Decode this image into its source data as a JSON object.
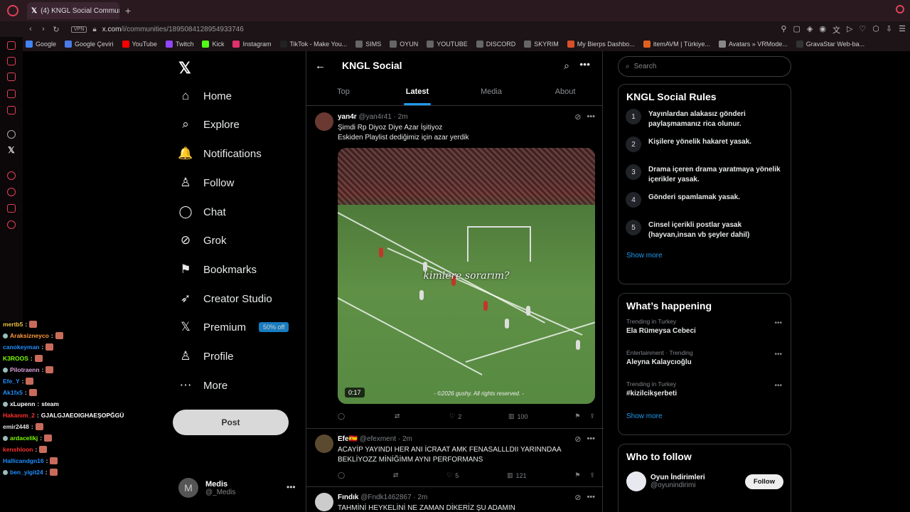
{
  "browser": {
    "tab_title": "(4) KNGL Social Commun",
    "new_tab": "+",
    "vpn": "VPN",
    "url_host": "x.com",
    "url_path": "/i/communities/1895084128954933746",
    "bookmarks": [
      {
        "label": "Google",
        "color": "#4285f4"
      },
      {
        "label": "Google Çeviri",
        "color": "#4a7be8"
      },
      {
        "label": "YouTube",
        "color": "#ff0000"
      },
      {
        "label": "Twitch",
        "color": "#9146ff"
      },
      {
        "label": "Kick",
        "color": "#53fc18"
      },
      {
        "label": "Instagram",
        "color": "#e1306c"
      },
      {
        "label": "TikTok - Make You...",
        "color": "#222"
      },
      {
        "label": "SIMS",
        "color": "#666"
      },
      {
        "label": "OYUN",
        "color": "#666"
      },
      {
        "label": "YOUTUBE",
        "color": "#666"
      },
      {
        "label": "DISCORD",
        "color": "#666"
      },
      {
        "label": "SKYRIM",
        "color": "#666"
      },
      {
        "label": "My Bierps Dashbo...",
        "color": "#d8502a"
      },
      {
        "label": "itemAVM | Türkiye...",
        "color": "#e06020"
      },
      {
        "label": "Avatars » VRMode...",
        "color": "#888"
      },
      {
        "label": "GravaStar Web-ba...",
        "color": "#333"
      }
    ]
  },
  "chat": [
    {
      "user": "mertb5",
      "color": "#f0c040",
      "text": ""
    },
    {
      "user": "Araksizneyco",
      "color": "#ff9a3c",
      "text": ""
    },
    {
      "user": "canokeyman",
      "color": "#1e90ff",
      "text": ""
    },
    {
      "user": "K3ROOS",
      "color": "#7cfc00",
      "text": ""
    },
    {
      "user": "Pilotraenn",
      "color": "#dda0dd",
      "text": ""
    },
    {
      "user": "Efe_Y",
      "color": "#1e90ff",
      "text": ""
    },
    {
      "user": "Ak1fx5",
      "color": "#1e90ff",
      "text": ""
    },
    {
      "user": "xLupenn",
      "color": "#ffffff",
      "text": "steam"
    },
    {
      "user": "Hakanım_2",
      "color": "#ff3030",
      "text": "GJALGJAEOIGHAEŞOPĞGÜ"
    },
    {
      "user": "emir2448",
      "color": "#e0e0e0",
      "text": ""
    },
    {
      "user": "ardacelikj",
      "color": "#7cfc00",
      "text": ""
    },
    {
      "user": "kenshloon",
      "color": "#ff3030",
      "text": ""
    },
    {
      "user": "Hallicandgn16",
      "color": "#1e90ff",
      "text": ""
    },
    {
      "user": "ben_yigit24",
      "color": "#1e90ff",
      "text": ""
    }
  ],
  "nav": {
    "items": [
      {
        "label": "Home",
        "icon": "⌂"
      },
      {
        "label": "Explore",
        "icon": "⌕"
      },
      {
        "label": "Notifications",
        "icon": "🔔"
      },
      {
        "label": "Follow",
        "icon": "♙"
      },
      {
        "label": "Chat",
        "icon": "◯"
      },
      {
        "label": "Grok",
        "icon": "⊘"
      },
      {
        "label": "Bookmarks",
        "icon": "⚑"
      },
      {
        "label": "Creator Studio",
        "icon": "➶"
      },
      {
        "label": "Premium",
        "icon": "𝕏"
      },
      {
        "label": "Profile",
        "icon": "♙"
      },
      {
        "label": "More",
        "icon": "⋯"
      }
    ],
    "premium_badge": "50% off",
    "post_label": "Post",
    "account_initial": "M",
    "account_name": "Medis",
    "account_handle": "@_Medis"
  },
  "community": {
    "title": "KNGL Social",
    "tabs": [
      "Top",
      "Latest",
      "Media",
      "About"
    ],
    "active_tab": "Latest"
  },
  "tweets": [
    {
      "name": "yan4r",
      "handle": "@yan4r41 · 2m",
      "text_1": "Şimdi Rp Diyoz Diye Azar İşitiyoz",
      "text_2": "Eskiden Playlist dediğimiz için azar yerdik",
      "video_caption": "kimlere sorarım?",
      "duration": "0:17",
      "watermark": "- ©2026 gushy. All rights reserved. -",
      "replies": "",
      "reposts": "",
      "likes": "2",
      "views": "100"
    },
    {
      "name": "Efe",
      "handle": "@efexment · 2m",
      "text_1": "ACAYİP YAYINDI HER ANI İCRAAT AMK FENASALLLDII YARINNDAA",
      "text_2": "BEKLİYOZZ MİNİĞİMM AYNI PERFORMANS",
      "likes": "5",
      "views": "121"
    },
    {
      "name": "Fındık",
      "handle": "@Fndk1462867 · 2m",
      "text_1": "TAHMİNİ HEYKELİNİ NE ZAMAN DİKERİZ ŞU ADAMIN"
    }
  ],
  "rules": {
    "title": "KNGL Social Rules",
    "items": [
      {
        "num": "1",
        "text": "Yayınlardan alakasız gönderi paylaşmamanız rica olunur."
      },
      {
        "num": "2",
        "text": "Kişilere yönelik hakaret yasak."
      },
      {
        "num": "3",
        "text": "Drama içeren drama yaratmaya yönelik içerikler yasak."
      },
      {
        "num": "4",
        "text": "Gönderi spamlamak yasak."
      },
      {
        "num": "5",
        "text": "Cinsel içerikli postlar yasak (hayvan,insan vb şeyler dahil)"
      }
    ],
    "show_more": "Show more"
  },
  "search": {
    "placeholder": "Search"
  },
  "happening": {
    "title": "What’s happening",
    "trends": [
      {
        "meta": "Trending in Turkey",
        "name": "Ela Rümeysa Cebeci"
      },
      {
        "meta": "Entertainment · Trending",
        "name": "Aleyna Kalaycıoğlu"
      },
      {
        "meta": "Trending in Turkey",
        "name": "#kizilcikşerbeti"
      }
    ],
    "show_more": "Show more"
  },
  "who_to_follow": {
    "title": "Who to follow",
    "accounts": [
      {
        "name": "Oyun İndirimleri",
        "handle": "@oyunindirimi",
        "button": "Follow"
      }
    ]
  }
}
